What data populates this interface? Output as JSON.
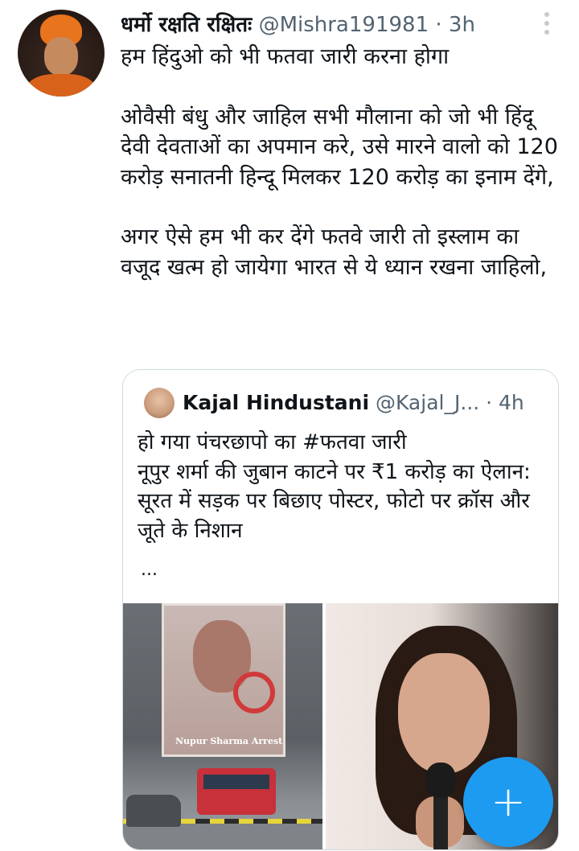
{
  "tweet": {
    "author": {
      "display_name": "धर्मो रक्षति रक्षितः",
      "handle": "@Mishra191981",
      "separator": "·",
      "time": "3h"
    },
    "body_paragraphs": [
      "हम हिंदुओ को भी फतवा जारी करना होगा",
      "ओवैसी बंधु और जाहिल सभी मौलाना को जो भी हिंदू देवी देवताओं का अपमान करे, उसे मारने वालो को 120 करोड़ सनातनी हिन्दू मिलकर 120 करोड़ का इनाम देंगे,",
      "अगर ऐसे हम भी कर देंगे फतवे जारी तो इस्लाम का वजूद खत्म हो जायेगा भारत से ये ध्यान रखना जाहिलो,"
    ],
    "more_icon": "more-vertical-icon"
  },
  "quote": {
    "author": {
      "display_name": "Kajal Hindustani",
      "handle": "@Kajal_J...",
      "time": "· 4h"
    },
    "body_lines": [
      "हो गया पंचरछापो का #फतवा जारी",
      "नूपुर शर्मा की जुबान काटने पर ₹1 करोड़ का ऐलान: सूरत में सड़क पर बिछाए पोस्टर, फोटो पर क्रॉस और जूते के निशान"
    ],
    "ellipsis": "...",
    "media": {
      "poster_caption": "Nupur Sharma Arrest"
    }
  },
  "fab": {
    "icon": "plus-icon",
    "label": "+",
    "color": "#1d9bf0"
  },
  "colors": {
    "text": "#0f1419",
    "secondary": "#536471",
    "border": "#cfd9de"
  }
}
